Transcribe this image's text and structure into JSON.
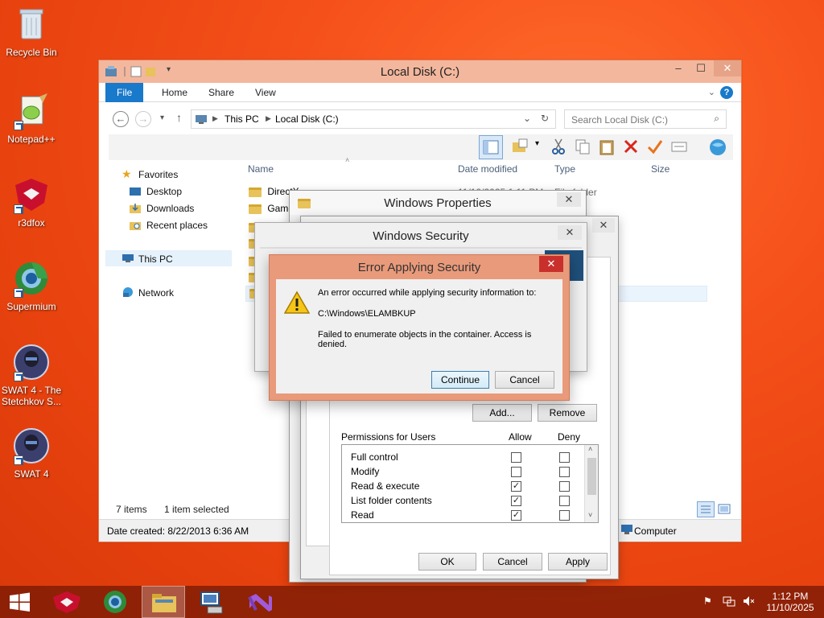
{
  "desktop": {
    "icons": [
      {
        "label": "Recycle Bin"
      },
      {
        "label": "Notepad++"
      },
      {
        "label": "r3dfox"
      },
      {
        "label": "Supermium"
      },
      {
        "label": "SWAT 4 - The Stetchkov S..."
      },
      {
        "label": "SWAT 4"
      }
    ]
  },
  "explorer": {
    "title": "Local Disk (C:)",
    "tabs": [
      "File",
      "Home",
      "Share",
      "View"
    ],
    "breadcrumb": [
      "This PC",
      "Local Disk (C:)"
    ],
    "search_placeholder": "Search Local Disk (C:)",
    "nav": {
      "favorites": "Favorites",
      "desktop": "Desktop",
      "downloads": "Downloads",
      "recent": "Recent places",
      "thispc": "This PC",
      "network": "Network"
    },
    "columns": {
      "name": "Name",
      "date": "Date modified",
      "type": "Type",
      "size": "Size"
    },
    "rows": [
      {
        "name": "DirectX",
        "date": "11/10/2025 1:11 PM",
        "type": "File folder"
      },
      {
        "name": "Game"
      }
    ],
    "status": {
      "items": "7 items",
      "selected": "1 item selected",
      "created": "Date created: 8/22/2013 6:36 AM",
      "computer": "Computer"
    }
  },
  "properties": {
    "title": "Windows Properties",
    "f_label": "F"
  },
  "security": {
    "title": "Windows Security",
    "add": "Add...",
    "remove": "Remove",
    "perm_header": "Permissions for Users",
    "allow": "Allow",
    "deny": "Deny",
    "permissions": [
      {
        "name": "Full control",
        "allow": false,
        "deny": false
      },
      {
        "name": "Modify",
        "allow": false,
        "deny": false
      },
      {
        "name": "Read & execute",
        "allow": true,
        "deny": false
      },
      {
        "name": "List folder contents",
        "allow": true,
        "deny": false
      },
      {
        "name": "Read",
        "allow": true,
        "deny": false
      }
    ],
    "ok": "OK",
    "cancel": "Cancel",
    "apply": "Apply"
  },
  "error": {
    "title": "Error Applying Security",
    "line1": "An error occurred while applying security information to:",
    "path": "C:\\Windows\\ELAMBKUP",
    "line2": "Failed to enumerate objects in the container. Access is denied.",
    "continue": "Continue",
    "cancel": "Cancel"
  },
  "taskbar": {
    "time": "1:12 PM",
    "date": "11/10/2025"
  },
  "colors": {
    "file_tab": "#1979ca",
    "titlebar": "#f3b79d",
    "error_frame": "#e99a7a"
  }
}
